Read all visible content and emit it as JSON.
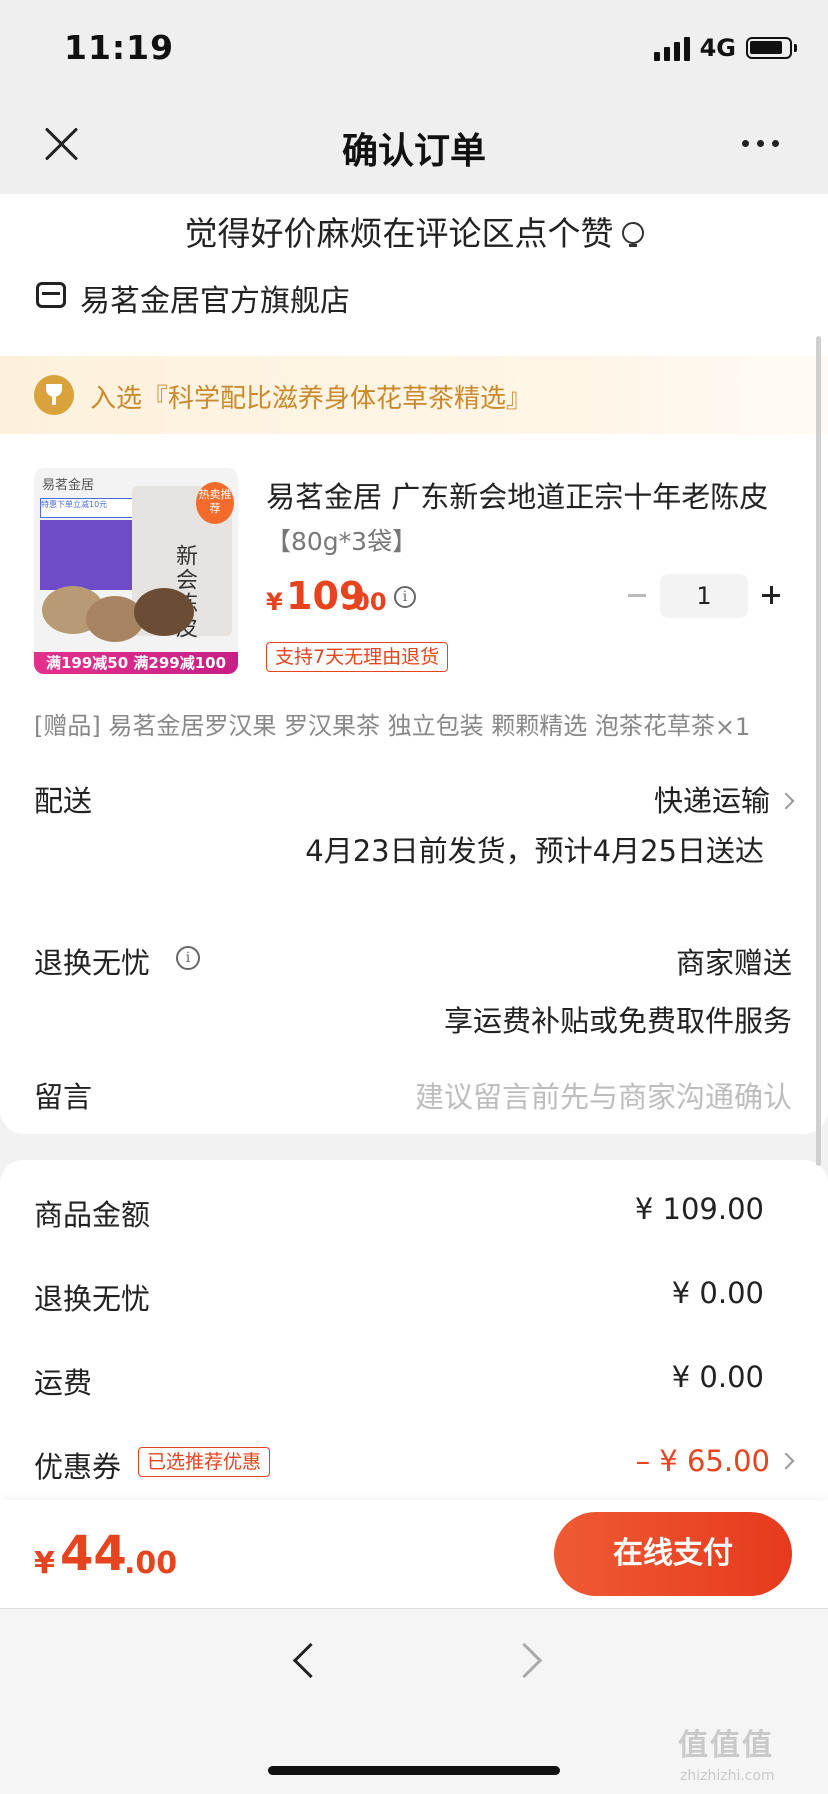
{
  "status": {
    "time": "11:19",
    "network": "4G"
  },
  "nav": {
    "title": "确认订单"
  },
  "banner": {
    "text": "觉得好价麻烦在评论区点个赞"
  },
  "shop": {
    "name": "易茗金居官方旗舰店"
  },
  "rank": {
    "text": "入选『科学配比滋养身体花草茶精选』"
  },
  "product": {
    "title": "易茗金居 广东新会地道正宗十年老陈皮",
    "spec": "【80g*3袋】",
    "price_symbol": "¥",
    "price_int": "109",
    "price_dec": ".00",
    "quantity": "1",
    "return_badge": "支持7天无理由退货",
    "image": {
      "logo": "易茗金居",
      "tag": "特惠下单立减10元",
      "bag_title": "新会陈皮",
      "hot": "热卖推荐",
      "promo": "满199减50 满299减100"
    }
  },
  "gift": {
    "text": "[赠品] 易茗金居罗汉果 罗汉果茶 独立包装 颗颗精选 泡茶花草茶",
    "qty": "×1"
  },
  "delivery": {
    "label": "配送",
    "method": "快递运输",
    "eta": "4月23日前发货，预计4月25日送达"
  },
  "worry_free": {
    "label": "退换无忧",
    "value": "商家赠送",
    "note": "享运费补贴或免费取件服务"
  },
  "message": {
    "label": "留言",
    "placeholder": "建议留言前先与商家沟通确认"
  },
  "summary": {
    "goods_label": "商品金额",
    "goods_value": "¥ 109.00",
    "worry_label": "退换无忧",
    "worry_value": "¥ 0.00",
    "ship_label": "运费",
    "ship_value": "¥ 0.00",
    "coupon_label": "优惠券",
    "coupon_badge": "已选推荐优惠",
    "coupon_value": "– ¥ 65.00"
  },
  "pay": {
    "symbol": "¥",
    "int": "44",
    "dec": ".00",
    "button": "在线支付"
  },
  "watermark": {
    "text": "值值值",
    "url": "zhizhizhi.com"
  },
  "colors": {
    "accent": "#e6441e",
    "rank_text": "#c9892c"
  }
}
